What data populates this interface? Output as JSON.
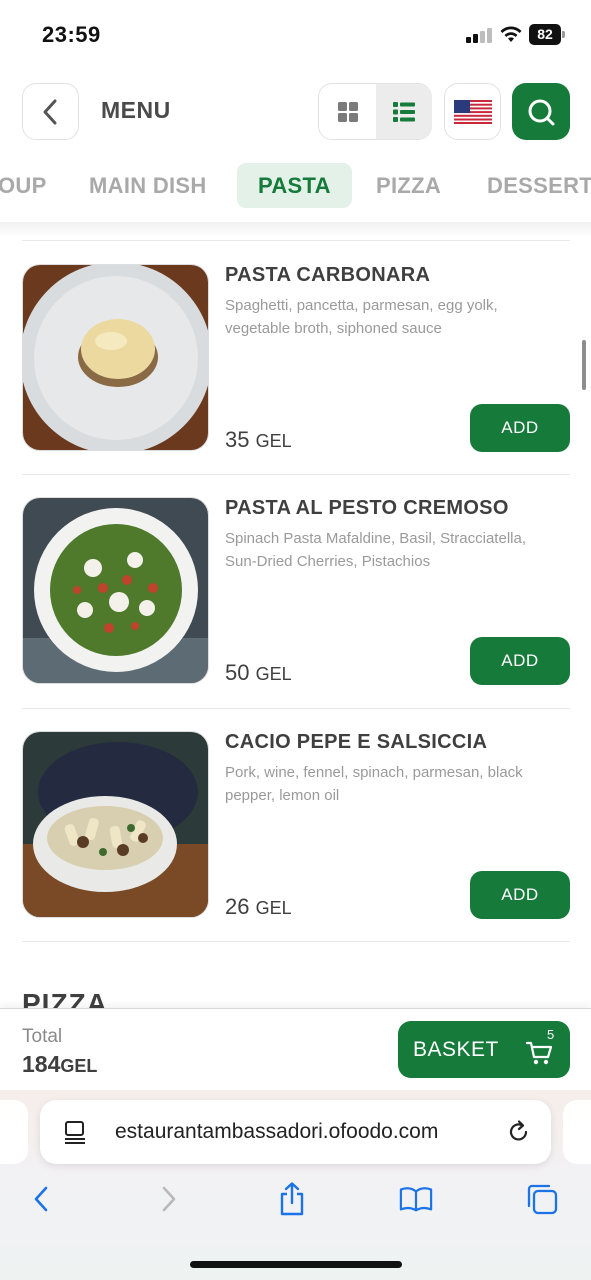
{
  "status_bar": {
    "time": "23:59",
    "battery": "82"
  },
  "header": {
    "title": "MENU"
  },
  "tabs": [
    {
      "label": "OUP"
    },
    {
      "label": "MAIN DISH"
    },
    {
      "label": "PASTA"
    },
    {
      "label": "PIZZA"
    },
    {
      "label": "DESSERT"
    }
  ],
  "items": [
    {
      "name": "PASTA CARBONARA",
      "description": "Spaghetti, pancetta, parmesan, egg yolk, vegetable broth, siphoned sauce",
      "price": "35",
      "currency": "GEL",
      "add_label": "ADD"
    },
    {
      "name": "PASTA AL PESTO CREMOSO",
      "description": "Spinach Pasta Mafaldine, Basil, Stracciatella, Sun-Dried Cherries, Pistachios",
      "price": "50",
      "currency": "GEL",
      "add_label": "ADD"
    },
    {
      "name": "CACIO PEPE E SALSICCIA",
      "description": "Pork, wine, fennel, spinach, parmesan, black pepper, lemon oil",
      "price": "26",
      "currency": "GEL",
      "add_label": "ADD"
    }
  ],
  "next_section": "PIZZA",
  "order_bar": {
    "total_label": "Total",
    "total_value": "184",
    "currency": "GEL",
    "basket_label": "BASKET",
    "basket_count": "5"
  },
  "browser": {
    "url": "estaurantambassadori.ofoodo.com"
  },
  "colors": {
    "brand_green": "#167a3b",
    "active_tab_bg": "#e4f1e8"
  },
  "icons": [
    "back-chevron-icon",
    "grid-view-icon",
    "list-view-icon",
    "us-flag-icon",
    "search-icon",
    "cart-icon",
    "reader-icon",
    "reload-icon",
    "share-icon",
    "bookmarks-icon",
    "tabs-icon"
  ]
}
